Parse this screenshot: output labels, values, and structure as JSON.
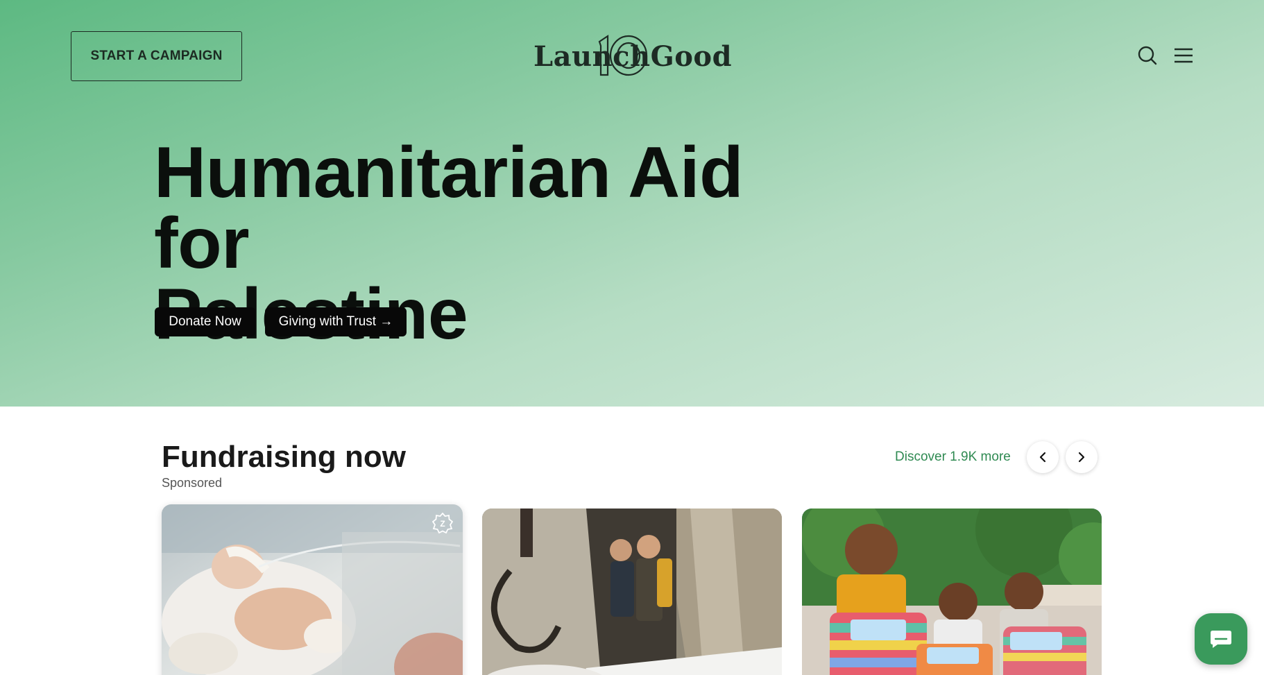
{
  "header": {
    "start_campaign_label": "START A CAMPAIGN",
    "logo_text": "LaunchGood",
    "logo_badge": "10",
    "search_icon": "search-icon",
    "menu_icon": "hamburger-menu-icon"
  },
  "hero": {
    "title_line1": "Humanitarian Aid for",
    "title_line2": "Palestine",
    "donate_label": "Donate Now",
    "trust_label": "Giving with Trust →"
  },
  "fundraising": {
    "title": "Fundraising now",
    "subtitle": "Sponsored",
    "discover_label": "Discover 1.9K more",
    "prev_icon": "chevron-left-icon",
    "next_icon": "chevron-right-icon",
    "cards": [
      {
        "image": "premature-baby-in-incubator",
        "badge": "zakat-badge-icon"
      },
      {
        "image": "children-in-snowy-tent"
      },
      {
        "image": "children-holding-winter-aid-blankets"
      }
    ]
  },
  "chat": {
    "icon": "chat-bubble-icon"
  },
  "colors": {
    "hero_green": "#5db982",
    "hero_light": "#d7ebdf",
    "link_green": "#2f8a52",
    "button_black": "#080808",
    "chat_green": "#3a9a5c"
  }
}
